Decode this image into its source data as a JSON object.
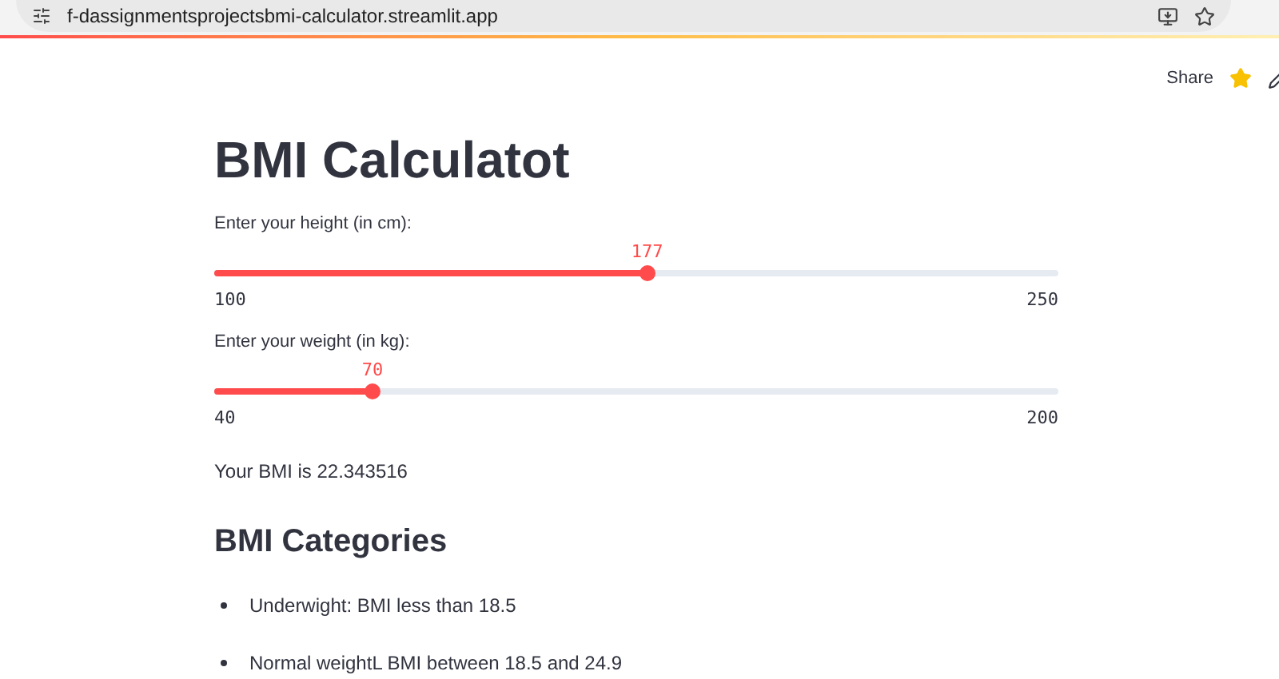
{
  "browser": {
    "url": "f-dassignmentsprojectsbmi-calculator.streamlit.app"
  },
  "header": {
    "share": "Share"
  },
  "title": "BMI Calculatot",
  "sliders": [
    {
      "label": "Enter your height (in cm):",
      "value": "177",
      "min": "100",
      "max": "250",
      "level": 0.513
    },
    {
      "label": "Enter your weight (in kg):",
      "value": "70",
      "min": "40",
      "max": "200",
      "level": 0.1875
    }
  ],
  "result": "Your BMI is 22.343516",
  "categories": {
    "heading": "BMI Categories",
    "items": [
      "Underwight: BMI less than 18.5",
      "Normal weightL BMI between 18.5 and 24.9"
    ]
  }
}
